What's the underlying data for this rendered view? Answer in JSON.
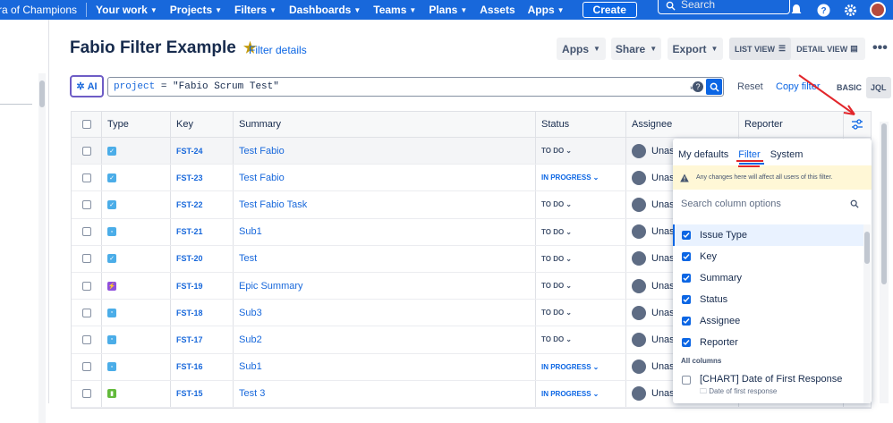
{
  "topnav": {
    "site": "ra of Champions",
    "items": [
      "Your work",
      "Projects",
      "Filters",
      "Dashboards",
      "Teams",
      "Plans",
      "Assets",
      "Apps"
    ],
    "create": "Create",
    "search_placeholder": "Search"
  },
  "page": {
    "title": "Fabio Filter Example",
    "filter_details": "Filter details",
    "apps": "Apps",
    "share": "Share",
    "export": "Export",
    "list_view": "LIST VIEW",
    "detail_view": "DETAIL VIEW",
    "more": "•••"
  },
  "query": {
    "ai_label": "AI",
    "jql_field": "project",
    "jql_op": " = ",
    "jql_value": "\"Fabio Scrum Test\"",
    "reset": "Reset",
    "copy_filter": "Copy filter",
    "basic": "BASIC",
    "jql": "JQL"
  },
  "table": {
    "headers": [
      "Type",
      "Key",
      "Summary",
      "Status",
      "Assignee",
      "Reporter"
    ],
    "rows": [
      {
        "type_color": "#4bade8",
        "type_glyph": "✓",
        "key": "FST-24",
        "summary": "Test Fabio",
        "status": "TO DO",
        "assignee": "Unas"
      },
      {
        "type_color": "#4bade8",
        "type_glyph": "✓",
        "key": "FST-23",
        "summary": "Test Fabio",
        "status": "IN PROGRESS",
        "assignee": "Unas"
      },
      {
        "type_color": "#4bade8",
        "type_glyph": "✓",
        "key": "FST-22",
        "summary": "Test Fabio Task",
        "status": "TO DO",
        "assignee": "Unas"
      },
      {
        "type_color": "#4bade8",
        "type_glyph": "▫",
        "key": "FST-21",
        "summary": "Sub1",
        "status": "TO DO",
        "assignee": "Unas"
      },
      {
        "type_color": "#4bade8",
        "type_glyph": "✓",
        "key": "FST-20",
        "summary": "Test",
        "status": "TO DO",
        "assignee": "Unas"
      },
      {
        "type_color": "#8f4fdd",
        "type_glyph": "⚡",
        "key": "FST-19",
        "summary": "Epic Summary",
        "status": "TO DO",
        "assignee": "Unas"
      },
      {
        "type_color": "#4bade8",
        "type_glyph": "▫",
        "key": "FST-18",
        "summary": "Sub3",
        "status": "TO DO",
        "assignee": "Unas"
      },
      {
        "type_color": "#4bade8",
        "type_glyph": "▫",
        "key": "FST-17",
        "summary": "Sub2",
        "status": "TO DO",
        "assignee": "Unas"
      },
      {
        "type_color": "#4bade8",
        "type_glyph": "▫",
        "key": "FST-16",
        "summary": "Sub1",
        "status": "IN PROGRESS",
        "assignee": "Unas"
      },
      {
        "type_color": "#63ba3c",
        "type_glyph": "▮",
        "key": "FST-15",
        "summary": "Test 3",
        "status": "IN PROGRESS",
        "assignee": "Unas"
      }
    ]
  },
  "column_panel": {
    "tabs": [
      "My defaults",
      "Filter",
      "System"
    ],
    "selected_tab": "Filter",
    "warning": "Any changes here will affect all users of this filter.",
    "search_placeholder": "Search column options",
    "selected": [
      "Issue Type",
      "Key",
      "Summary",
      "Status",
      "Assignee",
      "Reporter"
    ],
    "all_columns_label": "All columns",
    "chart_option": "[CHART] Date of First Response",
    "chart_option_sub": "Date of first response"
  },
  "colors": {
    "nav": "#1868db",
    "link": "#0c66e4",
    "annotation": "#e2262b"
  }
}
